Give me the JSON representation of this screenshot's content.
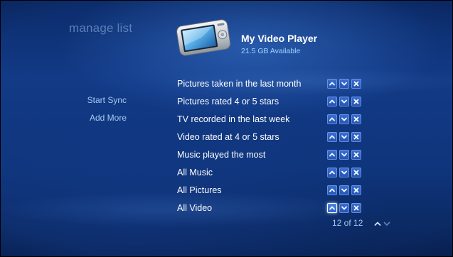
{
  "page": {
    "title": "manage list"
  },
  "device": {
    "name": "My Video Player",
    "available": "21.5 GB Available",
    "icon": "portable-media-player-icon"
  },
  "side_actions": [
    {
      "label": "Start Sync"
    },
    {
      "label": "Add More"
    }
  ],
  "list": {
    "items": [
      {
        "label": "Pictures taken in the last month"
      },
      {
        "label": "Pictures rated 4 or 5 stars"
      },
      {
        "label": "TV recorded in the last week"
      },
      {
        "label": "Video rated at 4 or 5 stars"
      },
      {
        "label": "Music played the most"
      },
      {
        "label": "All Music"
      },
      {
        "label": "All Pictures"
      },
      {
        "label": "All Video"
      }
    ],
    "row_controls": {
      "up_icon": "chevron-up-icon",
      "down_icon": "chevron-down-icon",
      "delete_icon": "close-icon"
    },
    "focused_control": "All Video / move up"
  },
  "pager": {
    "text": "12 of 12"
  },
  "colors": {
    "background": "#123a86",
    "title": "#5b7fb8",
    "text": "#ffffff",
    "accent_text": "#a6c9f3",
    "button": "#2d5fc2"
  }
}
